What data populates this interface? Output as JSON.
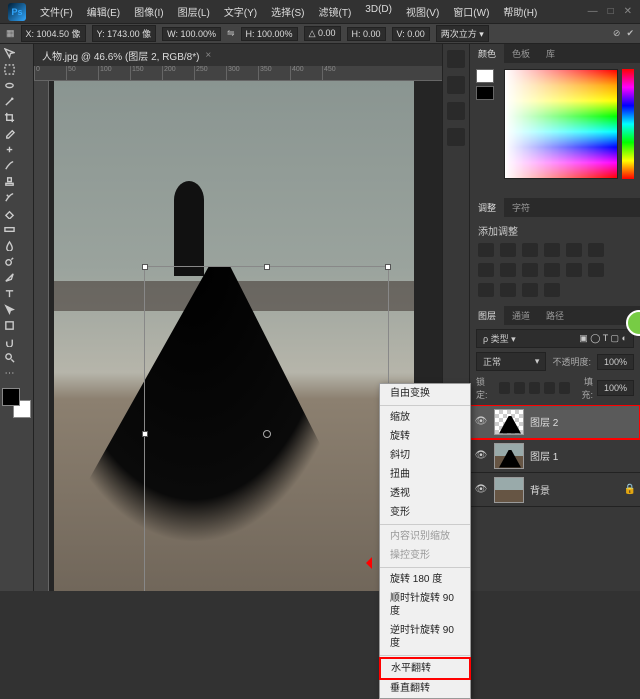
{
  "app": {
    "logo": "Ps"
  },
  "menubar": [
    "文件(F)",
    "编辑(E)",
    "图像(I)",
    "图层(L)",
    "文字(Y)",
    "选择(S)",
    "滤镜(T)",
    "3D(D)",
    "视图(V)",
    "窗口(W)",
    "帮助(H)"
  ],
  "optionsbar": {
    "x": "X: 1004.50 像",
    "y": "Y: 1743.00 像",
    "w": "W: 100.00%",
    "h": "H: 100.00%",
    "angle": "△ 0.00",
    "hskew": "H: 0.00",
    "vskew": "V: 0.00",
    "interp": "两次立方 ▾"
  },
  "document": {
    "title": "人物.jpg @ 46.6% (图层 2, RGB/8*)"
  },
  "ruler_marks": [
    "0",
    "50",
    "100",
    "150",
    "200",
    "250",
    "300",
    "350",
    "400",
    "450"
  ],
  "context_menu": {
    "items": [
      {
        "label": "自由变换",
        "disabled": false
      },
      {
        "sep": true
      },
      {
        "label": "缩放",
        "disabled": false
      },
      {
        "label": "旋转",
        "disabled": false
      },
      {
        "label": "斜切",
        "disabled": false
      },
      {
        "label": "扭曲",
        "disabled": false
      },
      {
        "label": "透视",
        "disabled": false
      },
      {
        "label": "变形",
        "disabled": false
      },
      {
        "sep": true
      },
      {
        "label": "内容识别缩放",
        "disabled": true
      },
      {
        "label": "操控变形",
        "disabled": true
      },
      {
        "sep": true
      },
      {
        "label": "旋转 180 度",
        "disabled": false
      },
      {
        "label": "顺时针旋转 90 度",
        "disabled": false
      },
      {
        "label": "逆时针旋转 90 度",
        "disabled": false
      },
      {
        "sep": true
      },
      {
        "label": "水平翻转",
        "disabled": false,
        "highlight": true
      },
      {
        "label": "垂直翻转",
        "disabled": false
      }
    ]
  },
  "panels": {
    "color_tabs": [
      "颜色",
      "色板",
      "库"
    ],
    "adjust_tabs": [
      "调整",
      "字符"
    ],
    "adjust_label": "添加调整",
    "layers_tabs": [
      "图层",
      "通道",
      "路径"
    ],
    "layer_filter": "ρ 类型 ▾",
    "blend_mode": "正常",
    "opacity_label": "不透明度:",
    "opacity_value": "100%",
    "lock_label": "锁定:",
    "fill_label": "填充:",
    "fill_value": "100%",
    "layers": [
      {
        "name": "图层 2",
        "active": true,
        "checker": true
      },
      {
        "name": "图层 1",
        "active": false,
        "checker": false
      },
      {
        "name": "背景",
        "active": false,
        "checker": false
      }
    ]
  }
}
